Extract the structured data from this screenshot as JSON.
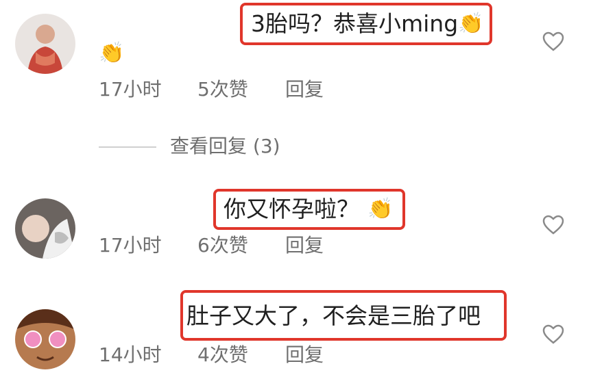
{
  "comments": [
    {
      "text": "3胎吗？恭喜小ming",
      "emoji": "👏",
      "emoji_line2": "👏",
      "time": "17小时",
      "likes": "5次赞",
      "reply": "回复"
    },
    {
      "text": "你又怀孕啦？",
      "emoji": "👏",
      "time": "17小时",
      "likes": "6次赞",
      "reply": "回复"
    },
    {
      "text": "肚子又大了，不会是三胎了吧",
      "time": "14小时",
      "likes": "4次赞",
      "reply": "回复"
    }
  ],
  "view_replies": "查看回复 (3)",
  "colors": {
    "highlight": "#e0362b",
    "meta": "#6f6f6f",
    "text": "#1f1f1f"
  }
}
